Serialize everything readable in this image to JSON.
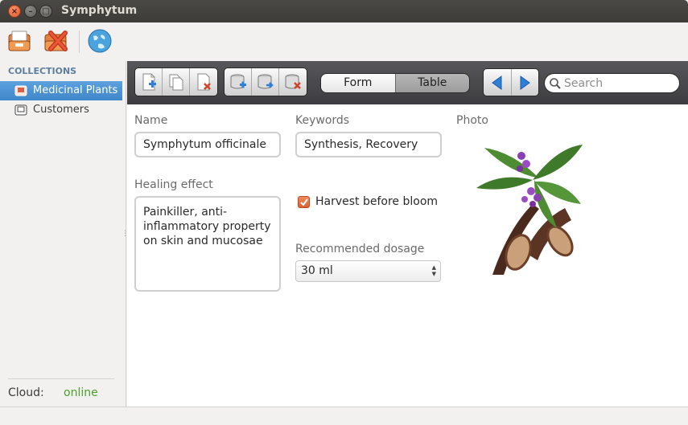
{
  "window": {
    "title": "Symphytum"
  },
  "toolbar": {
    "icons": [
      "new-collection-icon",
      "delete-collection-icon",
      "cloud-sync-icon"
    ]
  },
  "sidebar": {
    "header": "COLLECTIONS",
    "items": [
      {
        "label": "Medicinal Plants",
        "active": true
      },
      {
        "label": "Customers",
        "active": false
      }
    ],
    "cloud_label": "Cloud:",
    "cloud_status": "online"
  },
  "content_toolbar": {
    "view_options": [
      "Form",
      "Table"
    ],
    "active_view": "Form",
    "search_placeholder": "Search"
  },
  "form": {
    "name_label": "Name",
    "name_value": "Symphytum officinale",
    "keywords_label": "Keywords",
    "keywords_value": "Synthesis, Recovery",
    "photo_label": "Photo",
    "healing_label": "Healing effect",
    "healing_value": "Painkiller, anti-inflammatory property on skin and mucosae",
    "harvest_label": "Harvest before bloom",
    "harvest_checked": true,
    "dosage_label": "Recommended dosage",
    "dosage_value": "30 ml"
  },
  "colors": {
    "accent": "#3f86c9",
    "online": "#4aa02c",
    "check": "#e06c3a"
  }
}
